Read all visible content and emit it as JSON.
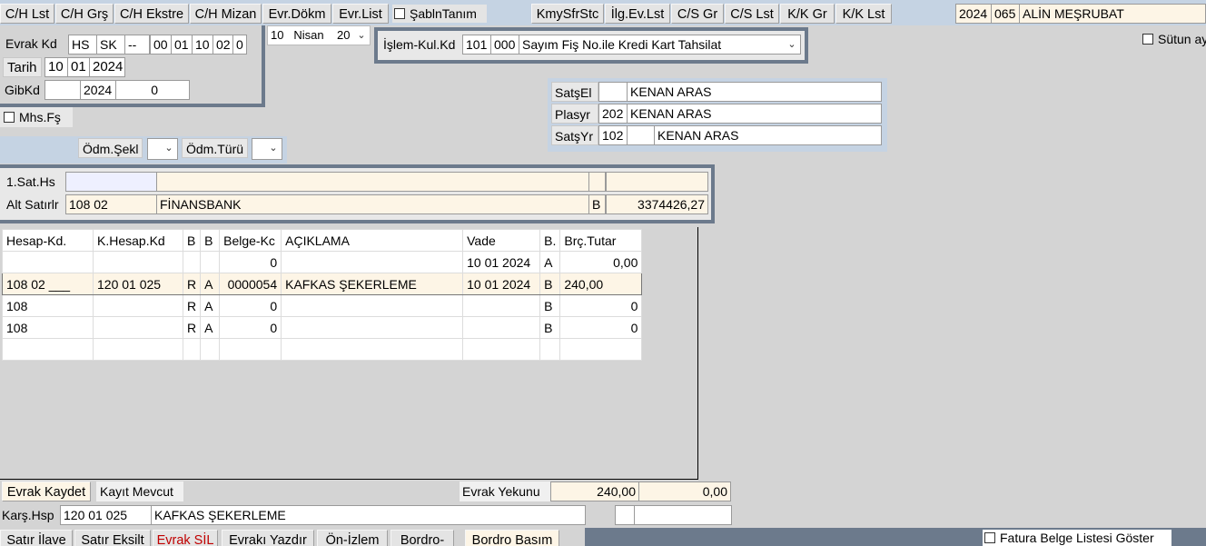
{
  "toolbar_left": [
    {
      "label": "C/H Lst"
    },
    {
      "label": "C/H Grş"
    },
    {
      "label": "C/H Ekstre"
    },
    {
      "label": "C/H Mizan"
    },
    {
      "label": "Evr.Dökm"
    },
    {
      "label": "Evr.List"
    }
  ],
  "sablon_label": "ŞablnTanım",
  "toolbar_right": [
    {
      "label": "KmySfrStc"
    },
    {
      "label": "İlg.Ev.Lst"
    },
    {
      "label": "C/S Gr"
    },
    {
      "label": "C/S Lst"
    },
    {
      "label": "K/K Gr"
    },
    {
      "label": "K/K Lst"
    }
  ],
  "company": {
    "year": "2024",
    "code": "065",
    "name": "ALİN MEŞRUBAT"
  },
  "sutun_label": "Sütun ay",
  "evrak": {
    "kd_label": "Evrak Kd",
    "kd_parts": [
      "HS",
      "SK",
      "--",
      "00",
      "01",
      "10",
      "02",
      "0"
    ],
    "tarih_label": "Tarih",
    "tarih_parts": [
      "10",
      "01",
      "2024"
    ],
    "gib_label": "GibKd",
    "gib_parts": [
      "",
      "2024",
      "0"
    ]
  },
  "period": {
    "day": "10",
    "month": "Nisan",
    "year": "20"
  },
  "islem": {
    "label": "İşlem-Kul.Kd",
    "code1": "101",
    "code2": "000",
    "type": "Sayım Fiş No.ile Kredi Kart Tahsilat"
  },
  "mhs_label": "Mhs.Fş",
  "sales": [
    {
      "label": "SatşEl",
      "code": "",
      "name": "KENAN ARAS"
    },
    {
      "label": "Plasyr",
      "code": "202",
      "name": "KENAN ARAS"
    },
    {
      "label": "SatşYr",
      "code": "102",
      "extra": "",
      "name": "KENAN ARAS"
    }
  ],
  "odeme": {
    "sekil_label": "Ödm.Şekl",
    "turu_label": "Ödm.Türü"
  },
  "satir": {
    "sat_hs_label": "1.Sat.Hs",
    "alt_label": "Alt Satırlr",
    "alt_code": "108 02",
    "alt_name": "FİNANSBANK",
    "alt_ba": "B",
    "alt_amount": "3374426,27"
  },
  "grid": {
    "headers": [
      "Hesap-Kd.",
      "K.Hesap.Kd",
      "B",
      "B",
      "Belge-Kc",
      "AÇIKLAMA",
      "Vade",
      "B.",
      "Brç.Tutar"
    ],
    "rows": [
      [
        "",
        "",
        "",
        "",
        "0",
        "",
        "10 01 2024",
        "A",
        "0,00"
      ],
      [
        "108 02 ___",
        "120 01 025",
        "R",
        "A",
        "0000054",
        "KAFKAS ŞEKERLEME",
        "10 01 2024",
        "B",
        "240,00"
      ],
      [
        "108",
        "",
        "R",
        "A",
        "0",
        "",
        "",
        "B",
        "0"
      ],
      [
        "108",
        "",
        "R",
        "A",
        "0",
        "",
        "",
        "B",
        "0"
      ],
      [
        "",
        "",
        "",
        "",
        "",
        "",
        "",
        "",
        ""
      ]
    ]
  },
  "footer": {
    "kaydet": "Evrak Kaydet",
    "mevcut": "Kayıt Mevcut",
    "yekun_label": "Evrak Yekunu",
    "yekun_borc": "240,00",
    "yekun_alacak": "0,00",
    "kars_label": "Karş.Hsp",
    "kars_code": "120 01 025",
    "kars_name": "KAFKAS ŞEKERLEME"
  },
  "bottom_buttons": [
    {
      "label": "Satır İlave"
    },
    {
      "label": "Satır Eksilt"
    },
    {
      "label": "Evrak SİL"
    },
    {
      "label": "Evrakı Yazdır"
    },
    {
      "label": "Ön-İzlem"
    },
    {
      "label": "Bordro-"
    },
    {
      "label": "Bordro Basım"
    }
  ],
  "fatura_label": "Fatura Belge Listesi Göster",
  "colors": {
    "frame": "#6c7a8c",
    "band": "#c5d3e3",
    "evrak_sil_text": "#c00000",
    "bottom_bar": "#6c7a8c"
  }
}
